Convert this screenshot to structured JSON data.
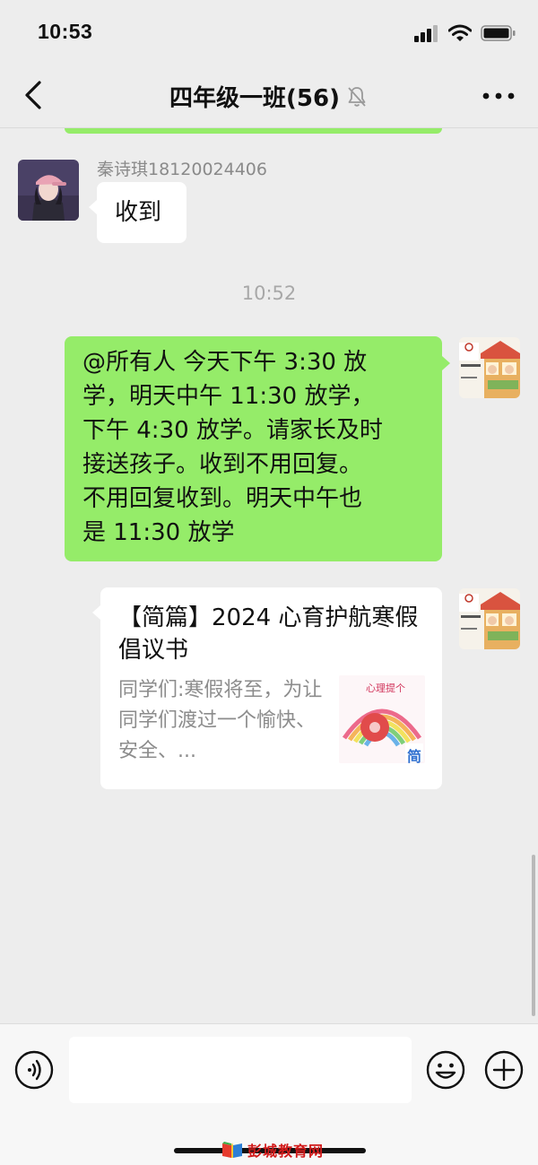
{
  "status_bar": {
    "time": "10:53"
  },
  "header": {
    "title": "四年级一班(56)",
    "muted": true
  },
  "messages": {
    "m1": {
      "sender": "秦诗琪18120024406",
      "text": "收到"
    },
    "timestamp": "10:52",
    "m2": {
      "lines": [
        "@所有人 今天下午 3:30 放",
        "学，明天中午 11:30 放学，",
        "下午 4:30 放学。请家长及时",
        "接送孩子。收到不用回复。",
        "不用回复收到。明天中午也",
        "是 11:30 放学"
      ]
    },
    "m3": {
      "title": "【简篇】2024 心育护航寒假倡议书",
      "description": "同学们:寒假将至，为让同学们渡过一个愉快、安全、...",
      "thumb_badge": "简"
    }
  },
  "watermark": {
    "text": "彭城教育网"
  },
  "colors": {
    "sent_bubble": "#95ec69",
    "received_bubble": "#ffffff",
    "background": "#ededed"
  }
}
